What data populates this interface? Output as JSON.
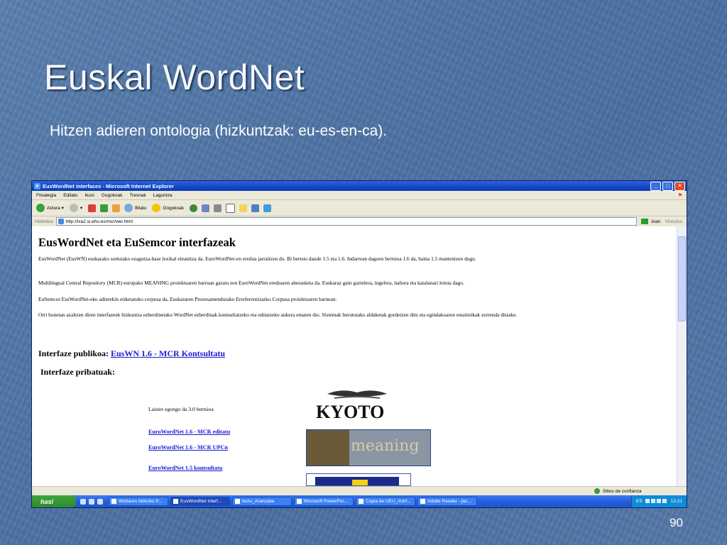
{
  "slide": {
    "title": "Euskal WordNet",
    "subtitle": "Hitzen adieren ontologia (hizkuntzak: eu-es-en-ca).",
    "page_number": "90"
  },
  "window": {
    "title": "EusWordNet interfaces - Microsoft Internet Explorer",
    "menu": [
      "Fitxategia",
      "Editatu",
      "Ikusi",
      "Gogokoak",
      "Tresnak",
      "Laguntza"
    ],
    "toolbar": {
      "back": "Atzera",
      "search": "Bilatu",
      "favorites": "Gogokoak"
    },
    "address_label": "Helbidea",
    "address_value": "http://ixa2.si.ehu.es/mcr/wei.html",
    "go_label": "Joan",
    "links_label": "Vinculos",
    "status_zone": "Sitios de confianza"
  },
  "page": {
    "heading": "EusWordNet eta EuSemcor interfazeak",
    "paragraphs": [
      "EusWordNet (EusWN) euskarako sortutako ezagutza-base lexikal eleanitza da. EuroWordNet-en eredua jarraitzen du. Bi bertsio daude 1.5 eta 1.6. Indarrean dagoen bertsioa 1.6 da, baina 1.5 mantentzen dugu.",
      "Multilingual Central Repository (MCR) europako MEANING proiektuaren barruan garatu zen EuroWordNet ereduaren aberasketa da. Euskaraz gain gaztelera, ingelera, italiera eta katalanari lotuta dago.",
      "EuSemcor EusWordNet-eko adierekin etiketatuko corpusa da, Euskararen Prozesamendurako Erreferentziazko Corpusa proiektuaren barnean.",
      "Orri honetan azaltzen diren interfazeek hizkuntza ezberdinetako WordNet ezberdinak kontsultatzeko eta editatzeko aukera ematen dio. Sistemak burututako aldaketak gordetzen ditu eta egindakoaren estatistikak zerrenda ditzake."
    ],
    "public_label": "Interfaze publikoa:",
    "public_link": "EusWN 1.6 - MCR Kontsultatu",
    "private_label": "Interfaze pribatuak:",
    "coming": "Laister egongo da 3.0 bertsioa",
    "links": [
      "EuroWordNet 1.6 - MCR editatu",
      "EuroWordNet 1.6 - MCR UPCn",
      "EuroWordNet 1.5 kontsultatu"
    ],
    "logo_kyoto": "KYOTO",
    "logo_meaning": "meaning"
  },
  "taskbar": {
    "start": "hasi",
    "tasks": [
      "Webaren bidezko P...",
      "EusWordNet interf...",
      "testu_Aranzabe",
      "Microsoft PowerPoi...",
      "Copia de UEU_morf...",
      "Adobe Reader - [az..."
    ],
    "lang": "ES",
    "clock": "12:21"
  },
  "colors": {
    "link": "#1a1ad6",
    "titlebar": "#1448c8",
    "slide_bg": "#4d72a3"
  }
}
